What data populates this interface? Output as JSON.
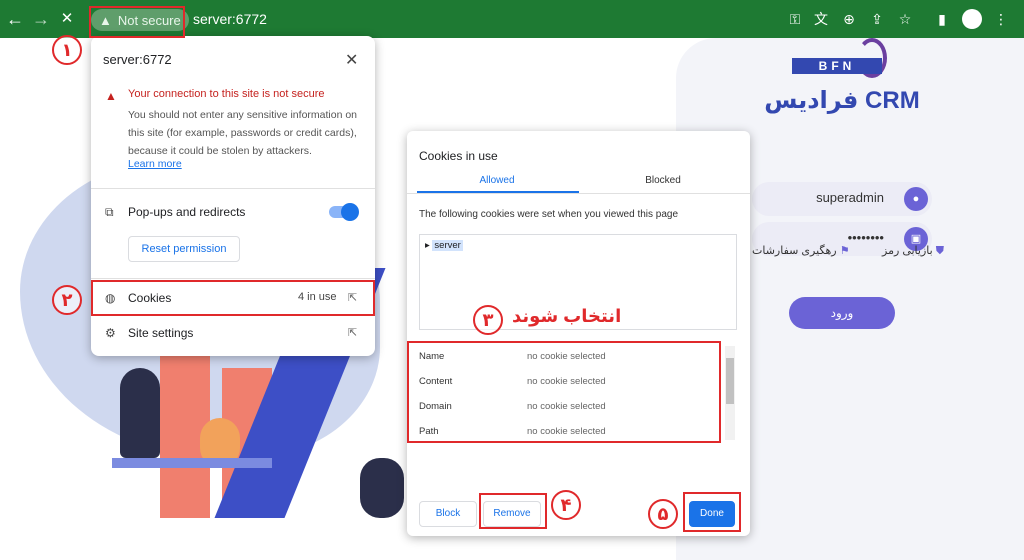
{
  "toolbar": {
    "back_icon": "←",
    "forward_icon": "→",
    "stop_icon": "✕",
    "security_chip": "Not secure",
    "url": "server:6772",
    "icons": [
      "key-icon",
      "translate-icon",
      "zoom-icon",
      "share-icon",
      "bookmark-star-icon",
      "sidepanel-icon",
      "profile-icon",
      "menu-icon"
    ]
  },
  "site_info": {
    "title": "server:6772",
    "warning_title": "Your connection to this site is not secure",
    "warning_body": "You should not enter any sensitive information on this site (for example, passwords or credit cards), because it could be stolen by attackers.",
    "learn_more": "Learn more",
    "popups_label": "Pop-ups and redirects",
    "reset_button": "Reset permission",
    "cookies_label": "Cookies",
    "cookies_count": "4 in use",
    "site_settings_label": "Site settings"
  },
  "cookies_dialog": {
    "title": "Cookies in use",
    "tabs": [
      {
        "label": "Allowed"
      },
      {
        "label": "Blocked"
      }
    ],
    "description": "The following cookies were set when you viewed this page",
    "tree_item": "server",
    "details": [
      {
        "key": "Name",
        "value": "no cookie selected"
      },
      {
        "key": "Content",
        "value": "no cookie selected"
      },
      {
        "key": "Domain",
        "value": "no cookie selected"
      },
      {
        "key": "Path",
        "value": "no cookie selected"
      }
    ],
    "block_button": "Block",
    "remove_button": "Remove",
    "done_button": "Done"
  },
  "login_page": {
    "logo_bfn": "BFN",
    "logo_text": "فرادیس CRM",
    "username": "superadmin",
    "password": "••••••••",
    "forgot_password": "بازیابی رمز",
    "track_orders": "رهگیری سفارشات",
    "login_button": "ورود"
  },
  "annotations": {
    "step1": "۱",
    "step2": "۲",
    "step3": "۳",
    "step4": "۴",
    "step5": "۵",
    "select_text": "انتخاب شوند"
  },
  "colors": {
    "toolbar": "#1e7a33",
    "annotation_red": "#e0292b",
    "link_blue": "#1a73e8",
    "brand_purple": "#6b63d6"
  }
}
